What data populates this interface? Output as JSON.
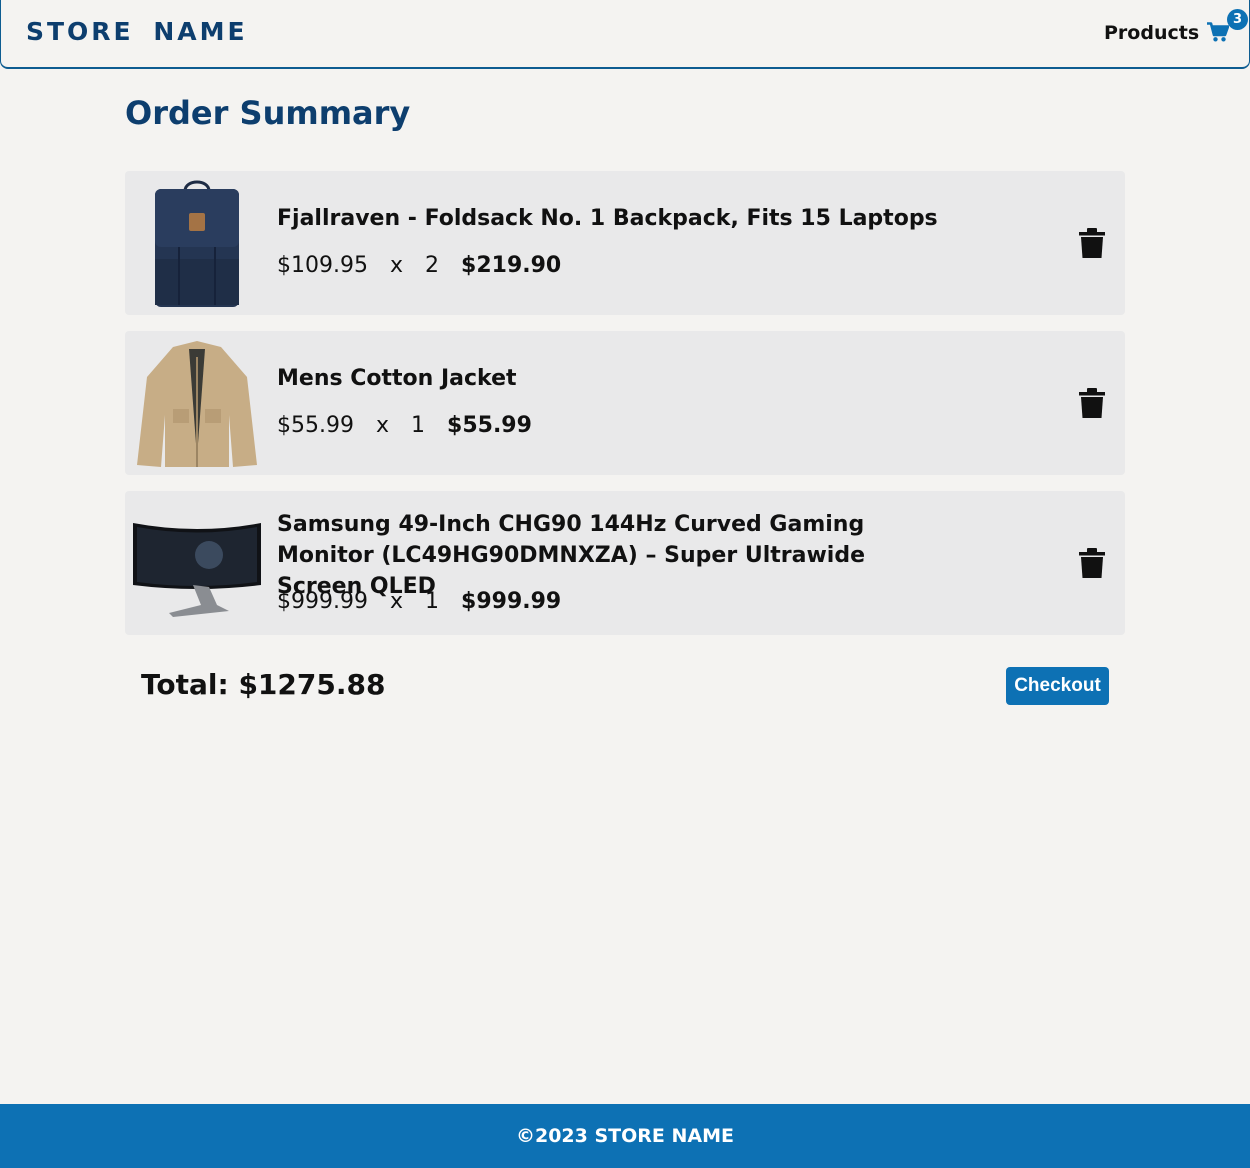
{
  "header": {
    "logo": "STORE NAME",
    "nav_products": "Products",
    "cart_count": "3"
  },
  "page": {
    "title": "Order Summary"
  },
  "cart": {
    "items": [
      {
        "name": "Fjallraven - Foldsack No. 1 Backpack, Fits 15 Laptops",
        "unit_price": "$109.95",
        "x": "x",
        "qty": "2",
        "line_total": "$219.90",
        "image": "backpack"
      },
      {
        "name": "Mens Cotton Jacket",
        "unit_price": "$55.99",
        "x": "x",
        "qty": "1",
        "line_total": "$55.99",
        "image": "jacket"
      },
      {
        "name": "Samsung 49-Inch CHG90 144Hz Curved Gaming Monitor (LC49HG90DMNXZA) – Super Ultrawide Screen QLED",
        "unit_price": "$999.99",
        "x": "x",
        "qty": "1",
        "line_total": "$999.99",
        "image": "monitor"
      }
    ],
    "total_label": "Total: $1275.88",
    "checkout_label": "Checkout"
  },
  "footer": {
    "text": "©2023 STORE NAME"
  },
  "colors": {
    "brand_dark": "#0d3e6e",
    "brand": "#0d71b4",
    "item_bg": "#e9e9ea",
    "page_bg": "#f4f3f1"
  },
  "icons": {
    "cart": "shopping-cart-icon",
    "delete": "trash-icon"
  }
}
